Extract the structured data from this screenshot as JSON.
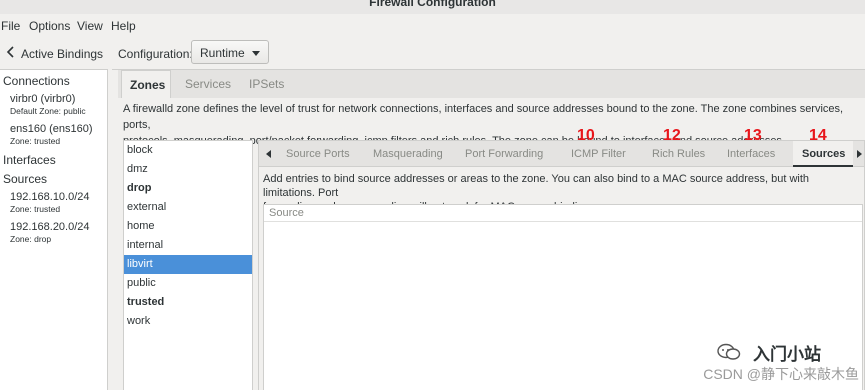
{
  "window": {
    "title": "Firewall Configuration"
  },
  "menubar": {
    "file": "File",
    "options": "Options",
    "view": "View",
    "help": "Help"
  },
  "bindings": {
    "label": "Active Bindings"
  },
  "left_panel": {
    "connections_header": "Connections",
    "connections": [
      {
        "name": "virbr0 (virbr0)",
        "zone": "Default Zone: public"
      },
      {
        "name": "ens160 (ens160)",
        "zone": "Zone: trusted"
      }
    ],
    "interfaces_header": "Interfaces",
    "sources_header": "Sources",
    "sources": [
      {
        "name": "192.168.10.0/24",
        "zone": "Zone: trusted"
      },
      {
        "name": "192.168.20.0/24",
        "zone": "Zone: drop"
      }
    ]
  },
  "config": {
    "label": "Configuration:",
    "value": "Runtime"
  },
  "top_tabs": [
    "Zones",
    "Services",
    "IPSets"
  ],
  "zone_description_line1": "A firewalld zone defines the level of trust for network connections, interfaces and source addresses bound to the zone. The zone combines services, ports,",
  "zone_description_line2": "protocols, masquerading, port/packet forwarding, icmp filters and rich rules. The zone can be bound to interfaces and source addresses.",
  "zones": [
    {
      "name": "block",
      "bold": false
    },
    {
      "name": "dmz",
      "bold": false
    },
    {
      "name": "drop",
      "bold": true
    },
    {
      "name": "external",
      "bold": false
    },
    {
      "name": "home",
      "bold": false
    },
    {
      "name": "internal",
      "bold": false
    },
    {
      "name": "libvirt",
      "bold": false,
      "selected": true
    },
    {
      "name": "public",
      "bold": false
    },
    {
      "name": "trusted",
      "bold": true
    },
    {
      "name": "work",
      "bold": false
    }
  ],
  "sub_tabs": [
    "Source Ports",
    "Masquerading",
    "Port Forwarding",
    "ICMP Filter",
    "Rich Rules",
    "Interfaces",
    "Sources"
  ],
  "annotations": [
    "10",
    "12",
    "13",
    "14"
  ],
  "sources_description_line1": "Add entries to bind source addresses or areas to the zone. You can also bind to a MAC source address, but with limitations. Port",
  "sources_description_line2": "forwarding and masquerading will not work for MAC source bindings.",
  "source_table": {
    "column": "Source"
  },
  "watermark": {
    "text": "CSDN @静下心来敲木鱼",
    "logo": "入门小站"
  },
  "colors": {
    "selection": "#4a90d9",
    "annotation": "#e8161b"
  }
}
